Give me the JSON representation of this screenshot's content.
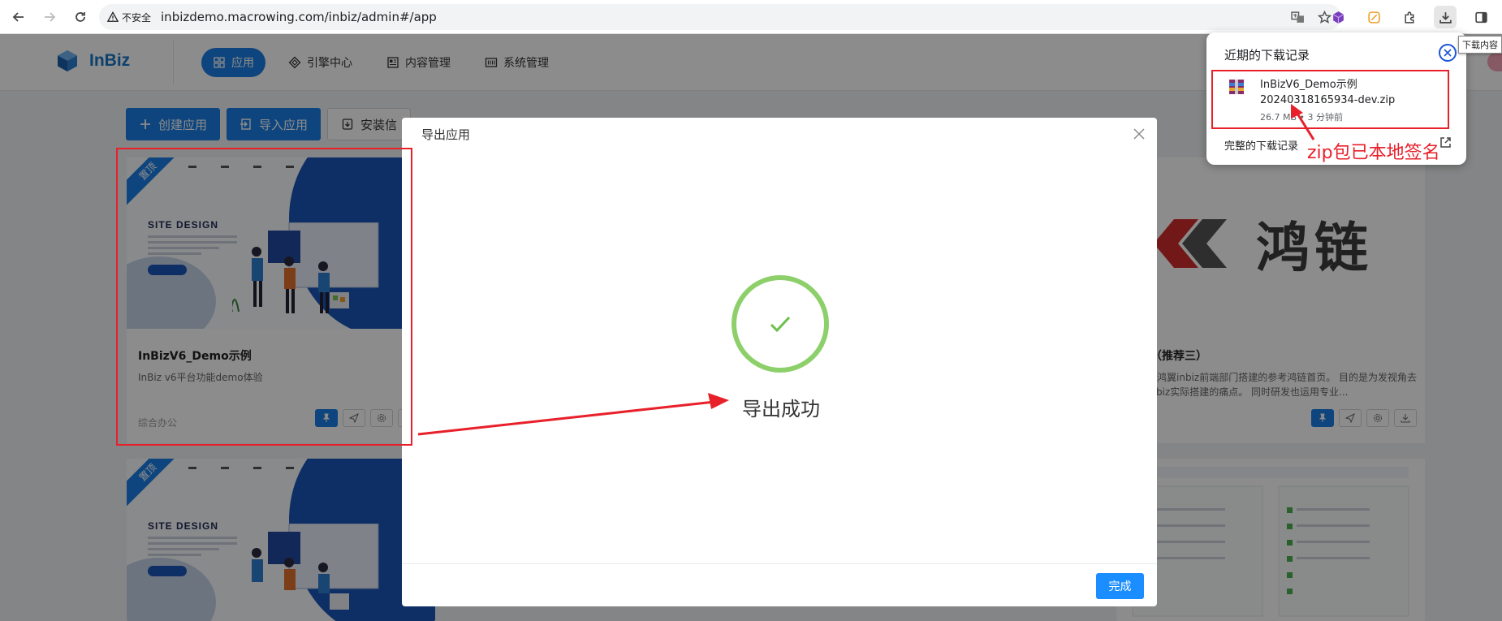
{
  "browser": {
    "security_label": "不安全",
    "url": "inbizdemo.macrowing.com/inbiz/admin#/app",
    "download_tooltip": "下载内容"
  },
  "app": {
    "logo_text": "InBiz",
    "nav": [
      {
        "label": "应用",
        "icon": "apps-icon",
        "active": true
      },
      {
        "label": "引擎中心",
        "icon": "engine-icon",
        "active": false
      },
      {
        "label": "内容管理",
        "icon": "content-icon",
        "active": false
      },
      {
        "label": "系统管理",
        "icon": "system-icon",
        "active": false
      }
    ]
  },
  "toolbar": {
    "create_label": "创建应用",
    "import_label": "导入应用",
    "install_label": "安装信"
  },
  "cards": {
    "card1": {
      "ribbon": "置顶",
      "site_title": "SITE DESIGN",
      "title": "InBizV6_Demo示例",
      "desc": "InBiz v6平台功能demo体验",
      "category": "综合办公"
    },
    "card2": {
      "brand": "鸿链",
      "title": "首页（推荐三）",
      "desc": "个出自鸿翼inbiz前端部门搭建的参考鸿链首页。 目的是为发视角去体验inbiz实际搭建的痛点。 同时研发也运用专业..."
    },
    "card3": {
      "ribbon": "置顶",
      "site_title": "SITE DESIGN"
    }
  },
  "modal": {
    "title": "导出应用",
    "success_text": "导出成功",
    "done_label": "完成"
  },
  "downloads": {
    "title": "近期的下载记录",
    "file_name": "InBizV6_Demo示例20240318165934-dev.zip",
    "file_meta": "26.7 MB • 3 分钟前",
    "all_label": "完整的下载记录"
  },
  "annotation": {
    "text": "zip包已本地签名",
    "color": "#e8202a"
  },
  "colors": {
    "primary": "#1a7ee6",
    "success": "#8dd06b"
  }
}
